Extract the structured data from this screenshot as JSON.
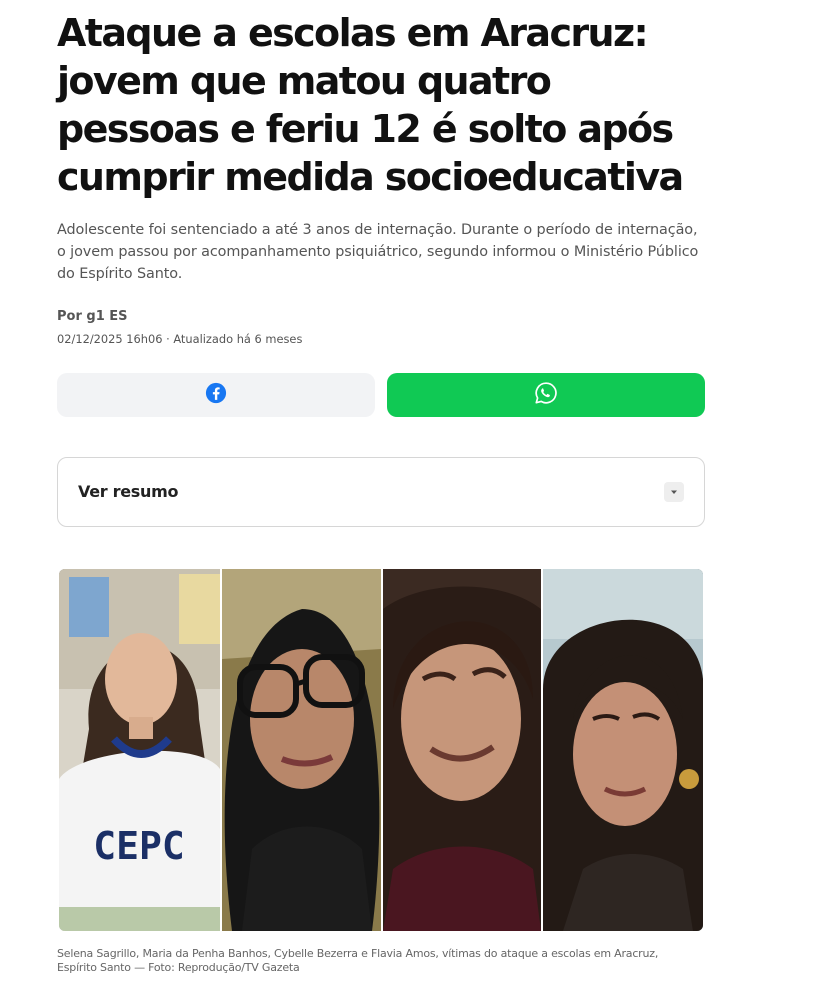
{
  "article": {
    "title": "Ataque a escolas em Aracruz: jovem que matou quatro pessoas e feriu 12 é solto após cumprir medida socioeducativa",
    "subtitle": "Adolescente foi sentenciado a até 3 anos de internação. Durante o período de internação, o jovem passou por acompanhamento psiquiátrico, segundo informou o Ministério Público do Espírito Santo.",
    "byline": "Por g1 ES",
    "dateline": "02/12/2025 16h06 · Atualizado há 6 meses"
  },
  "share": {
    "facebook_icon": "facebook-icon",
    "whatsapp_icon": "whatsapp-icon",
    "facebook_color": "#1877f2",
    "whatsapp_color": "#10c954"
  },
  "summary": {
    "label": "Ver resumo",
    "toggle_icon": "caret-down-icon"
  },
  "photo": {
    "panels": [
      {
        "shirt_text": "CEPC"
      },
      {},
      {},
      {}
    ],
    "caption": "Selena Sagrillo, Maria da Penha Banhos, Cybelle Bezerra e Flavia Amos, vítimas do ataque a escolas em Aracruz, Espírito Santo — Foto: Reprodução/TV Gazeta"
  }
}
